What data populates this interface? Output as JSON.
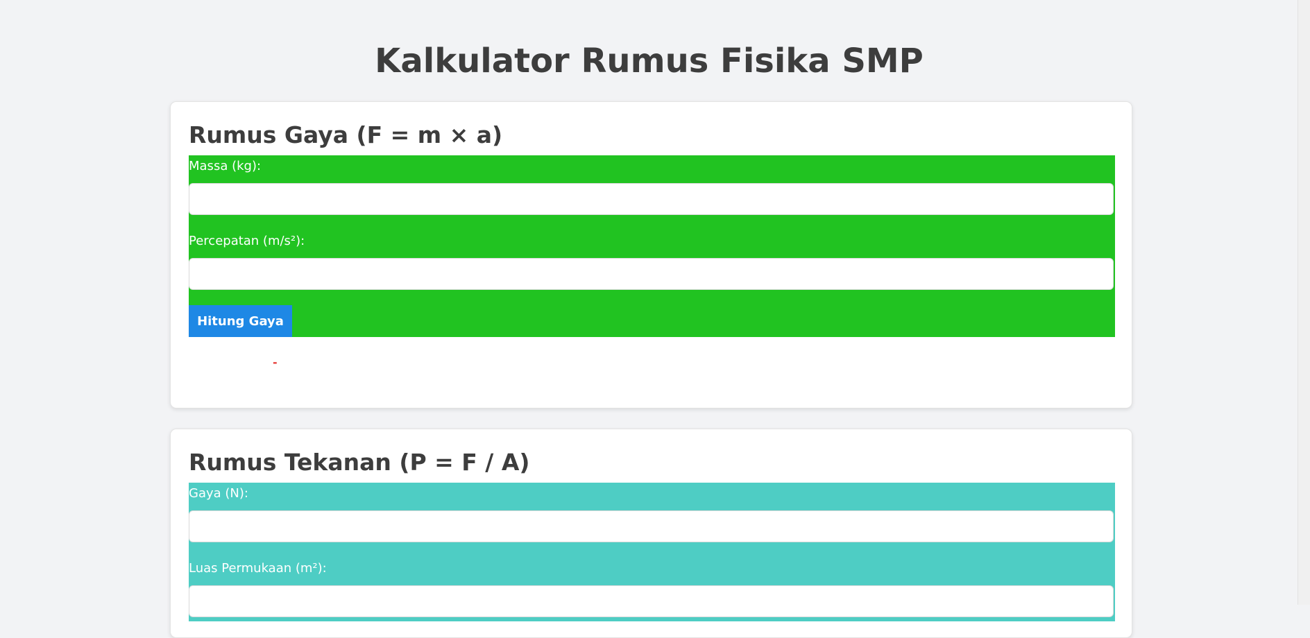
{
  "page": {
    "title": "Kalkulator Rumus Fisika SMP"
  },
  "gaya": {
    "title": "Rumus Gaya (F = m × a)",
    "mass_label": "Massa (kg):",
    "mass_value": "",
    "accel_label": "Percepatan (m/s²):",
    "accel_value": "",
    "button_label": "Hitung Gaya",
    "result": "-",
    "colors": {
      "form_background": "#21c321",
      "button": "#1e88e5",
      "result": "#e53935"
    }
  },
  "tekanan": {
    "title": "Rumus Tekanan (P = F / A)",
    "force_label": "Gaya (N):",
    "force_value": "",
    "area_label": "Luas Permukaan (m²):",
    "area_value": "",
    "colors": {
      "form_background": "#4ecdc4"
    }
  }
}
